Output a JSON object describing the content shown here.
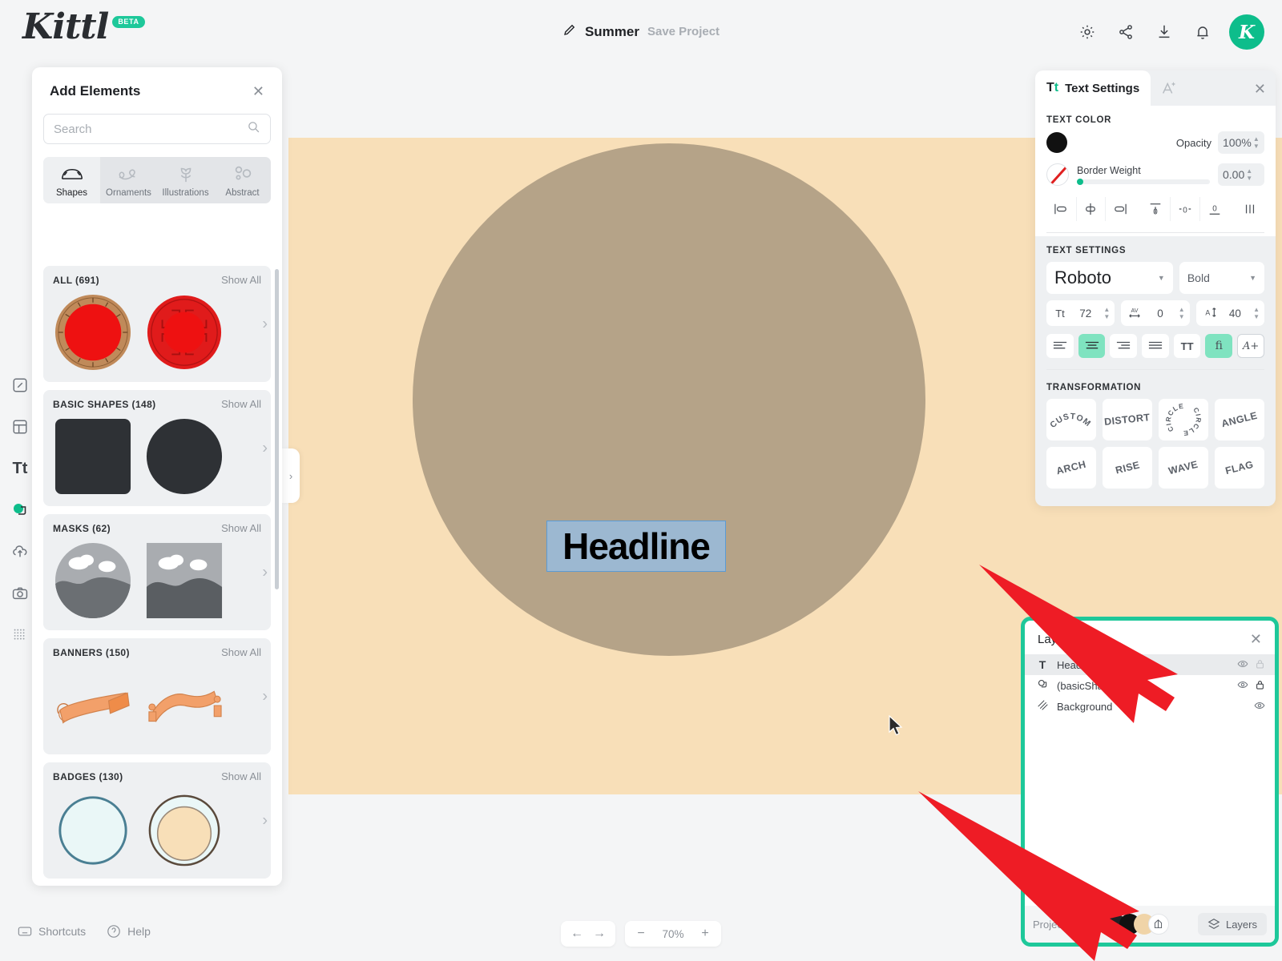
{
  "app": {
    "brand": "Kittl",
    "badge": "BETA"
  },
  "topbar": {
    "project_name": "Summer",
    "save_label": "Save Project",
    "icons": [
      "gear-icon",
      "share-icon",
      "download-icon",
      "bell-icon"
    ],
    "avatar_letter": "K",
    "avatar_color": "#0dbd8b"
  },
  "left_rail": {
    "items": [
      {
        "name": "design-icon",
        "glyph": "edit"
      },
      {
        "name": "templates-icon",
        "glyph": "layout"
      },
      {
        "name": "text-icon",
        "glyph": "Tt"
      },
      {
        "name": "elements-icon",
        "glyph": "shapes",
        "active": true
      },
      {
        "name": "uploads-icon",
        "glyph": "upload-cloud"
      },
      {
        "name": "photos-icon",
        "glyph": "camera"
      },
      {
        "name": "textures-icon",
        "glyph": "dots-grid"
      }
    ]
  },
  "add_panel": {
    "title": "Add Elements",
    "close_icon": "close-icon",
    "search": {
      "placeholder": "Search",
      "value": "",
      "icon": "search-icon"
    },
    "tabs": [
      {
        "label": "Shapes",
        "icon": "shapes-icon",
        "active": true
      },
      {
        "label": "Ornaments",
        "icon": "ornament-icon",
        "active": false
      },
      {
        "label": "Illustrations",
        "icon": "flower-icon",
        "active": false
      },
      {
        "label": "Abstract",
        "icon": "abstract-icon",
        "active": false
      }
    ],
    "show_all_label": "Show All",
    "categories": [
      {
        "name": "ALL (691)",
        "kind": "ornate-circles"
      },
      {
        "name": "BASIC SHAPES (148)",
        "kind": "basic"
      },
      {
        "name": "MASKS (62)",
        "kind": "masks"
      },
      {
        "name": "BANNERS (150)",
        "kind": "banners"
      },
      {
        "name": "BADGES (130)",
        "kind": "badges"
      }
    ],
    "collapse_handle_icon": "chevron-right-icon"
  },
  "canvas": {
    "artboard_color": "#f8dfb8",
    "shape_color": "#b5a388",
    "headline_text": "Headline",
    "selection_fill": "#9cb8d1",
    "selection_border": "#5b9bd5"
  },
  "text_panel": {
    "tab_label": "Text Settings",
    "tab_icon": "text-settings-icon",
    "ai_tab_icon": "ai-text-icon",
    "close_icon": "close-icon",
    "text_color": {
      "section": "TEXT COLOR",
      "swatch": "#111111",
      "opacity_label": "Opacity",
      "opacity_value": "100%"
    },
    "border": {
      "label": "Border Weight",
      "value": "0.00",
      "swatch_icon": "no-color-icon"
    },
    "align_group_1": [
      "align-start-icon",
      "align-center-h-icon",
      "align-end-icon"
    ],
    "align_group_2": [
      "align-top-icon",
      "align-middle-v-icon",
      "align-bottom-icon"
    ],
    "align_group_3": [
      "distribute-icon"
    ],
    "settings": {
      "section": "TEXT SETTINGS",
      "font_family": "Roboto",
      "font_weight": "Bold",
      "font_size_icon": "font-size-icon",
      "font_size": "72",
      "letter_spacing_icon": "letter-spacing-icon",
      "letter_spacing": "0",
      "line_height_icon": "line-height-icon",
      "line_height": "40"
    },
    "format_buttons": [
      {
        "name": "text-align-left",
        "glyph": "align-left-icon",
        "selected": false
      },
      {
        "name": "text-align-center",
        "glyph": "align-center-icon",
        "selected": true
      },
      {
        "name": "text-align-right",
        "glyph": "align-right-icon",
        "selected": false
      },
      {
        "name": "text-align-justify",
        "glyph": "align-justify-icon",
        "selected": false
      },
      {
        "name": "uppercase-toggle",
        "glyph": "TT",
        "selected": false
      },
      {
        "name": "ligatures-toggle",
        "glyph": "fi",
        "selected": true
      },
      {
        "name": "more-typography",
        "glyph": "A+",
        "selected": false,
        "outline": true
      }
    ],
    "transformation": {
      "section": "TRANSFORMATION",
      "buttons": [
        {
          "label": "CUSTOM",
          "style": "arc"
        },
        {
          "label": "DISTORT",
          "style": "flat"
        },
        {
          "label": "CIRCLE",
          "style": "circle"
        },
        {
          "label": "ANGLE",
          "style": "angle"
        },
        {
          "label": "ARCH",
          "style": "arch"
        },
        {
          "label": "RISE",
          "style": "rise"
        },
        {
          "label": "WAVE",
          "style": "wave"
        },
        {
          "label": "FLAG",
          "style": "flag"
        }
      ]
    }
  },
  "layers_panel": {
    "title": "Layers",
    "close_icon": "close-icon",
    "highlight_color": "#1ec89a",
    "rows": [
      {
        "icon": "text-layer-icon",
        "name": "Headline",
        "selected": true,
        "visible": true,
        "locked": true,
        "lock_dim": true
      },
      {
        "icon": "shape-layer-icon",
        "name": "(basicShape)",
        "selected": false,
        "visible": true,
        "locked": true,
        "lock_dim": false
      },
      {
        "icon": "background-layer-icon",
        "name": "Background",
        "selected": false,
        "visible": true,
        "locked": false,
        "lock_dim": false
      }
    ],
    "footer": {
      "project_colors_label": "Project Colors",
      "color_dots": [
        "#1f2125",
        "#111111",
        "#f0d4a8"
      ],
      "edit_icon": "color-edit-icon",
      "layers_button_label": "Layers",
      "layers_button_icon": "layers-icon"
    }
  },
  "bottombar": {
    "shortcuts_label": "Shortcuts",
    "shortcuts_icon": "keyboard-icon",
    "help_label": "Help",
    "help_icon": "question-icon",
    "undo_icon": "undo-icon",
    "redo_icon": "redo-icon",
    "zoom_out": "−",
    "zoom_value": "70%",
    "zoom_in": "+"
  },
  "annotations": {
    "arrow_color": "#ee1c25",
    "arrows": 2
  }
}
